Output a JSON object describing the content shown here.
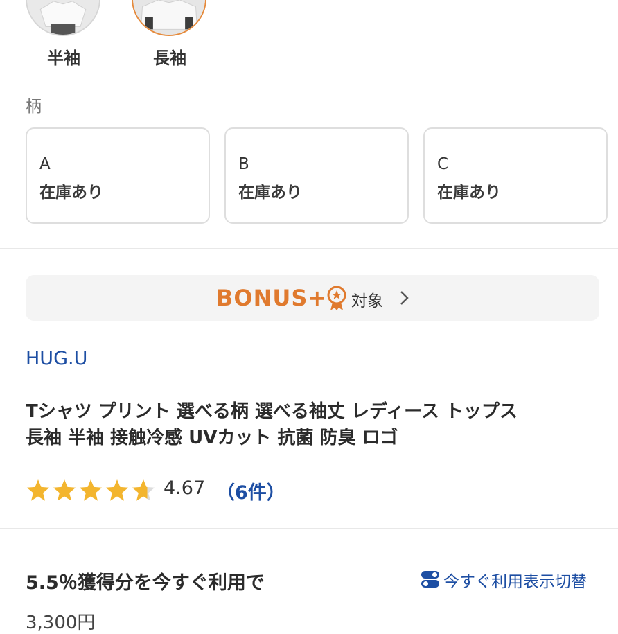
{
  "sleeve_options": [
    {
      "label": "半袖",
      "selected": false
    },
    {
      "label": "長袖",
      "selected": true
    }
  ],
  "pattern": {
    "label": "柄",
    "options": [
      {
        "name": "A",
        "stock": "在庫あり"
      },
      {
        "name": "B",
        "stock": "在庫あり"
      },
      {
        "name": "C",
        "stock": "在庫あり"
      }
    ]
  },
  "bonus": {
    "logo_text": "BONUS+",
    "target_label": "対象",
    "color": "#e07a2e"
  },
  "shop": {
    "name": "HUG.U"
  },
  "product": {
    "title_line1": "Tシャツ プリント 選べる柄 選べる袖丈 レディース トップス",
    "title_line2": "長袖 半袖 接触冷感 UVカット 抗菌 防臭 ロゴ"
  },
  "rating": {
    "stars": 4.67,
    "value_text": "4.67",
    "count_text": "（6件）",
    "star_color": "#f3b52e"
  },
  "points": {
    "text": "5.5％獲得分を今すぐ利用で",
    "toggle_label": "今すぐ利用表示切替",
    "toggle_icon": "toggle-icon"
  },
  "price_partial": "3,300円"
}
